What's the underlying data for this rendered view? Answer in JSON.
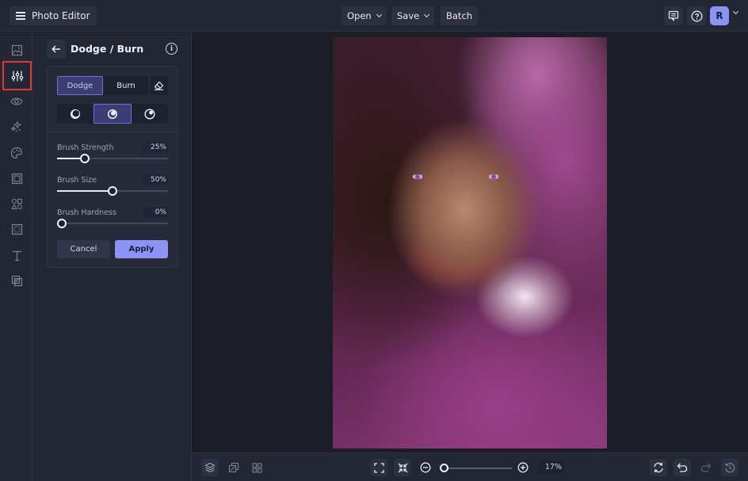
{
  "app": {
    "title": "Photo Editor"
  },
  "topbar": {
    "menu": [
      {
        "label": "Open",
        "has_dropdown": true
      },
      {
        "label": "Save",
        "has_dropdown": true
      },
      {
        "label": "Batch",
        "has_dropdown": false
      }
    ],
    "right_icons": [
      "feedback-icon",
      "help-icon"
    ],
    "avatar_initial": "R"
  },
  "rail": {
    "items": [
      {
        "name": "image",
        "icon": "image-icon",
        "active": false
      },
      {
        "name": "adjustments",
        "icon": "sliders-icon",
        "active": true
      },
      {
        "name": "effects",
        "icon": "eye-icon",
        "active": false
      },
      {
        "name": "touch-up",
        "icon": "sparkles-icon",
        "active": false
      },
      {
        "name": "artsy",
        "icon": "palette-icon",
        "active": false
      },
      {
        "name": "frames",
        "icon": "frame-icon",
        "active": false
      },
      {
        "name": "graphics",
        "icon": "shapes-icon",
        "active": false
      },
      {
        "name": "textures",
        "icon": "texture-icon",
        "active": false
      },
      {
        "name": "text",
        "icon": "text-icon",
        "active": false
      },
      {
        "name": "overlays",
        "icon": "overlay-icon",
        "active": false
      }
    ]
  },
  "panel": {
    "title": "Dodge / Burn",
    "mode_tabs": [
      {
        "label": "Dodge",
        "active": true
      },
      {
        "label": "Burn",
        "active": false
      }
    ],
    "eraser_icon": "eraser-icon",
    "tone_ranges": [
      {
        "name": "shadows",
        "active": false
      },
      {
        "name": "midtones",
        "active": true
      },
      {
        "name": "highlights",
        "active": false
      }
    ],
    "sliders": [
      {
        "label": "Brush Strength",
        "value": 25,
        "display": "25%"
      },
      {
        "label": "Brush Size",
        "value": 50,
        "display": "50%"
      },
      {
        "label": "Brush Hardness",
        "value": 0,
        "display": "0%"
      }
    ],
    "cancel_label": "Cancel",
    "apply_label": "Apply"
  },
  "colors": {
    "accent": "#8b93f5",
    "active_highlight": "#e0392b",
    "background": "#1d1f28",
    "panel": "#232633"
  },
  "bottombar": {
    "left_icons": [
      "layers-icon",
      "replace-image-icon",
      "grid-icon"
    ],
    "fit_icons": [
      "fit-screen-icon",
      "actual-size-icon"
    ],
    "zoom": {
      "value": 17,
      "display": "17%"
    },
    "right_icons": [
      "rotate-refresh-icon",
      "undo-icon",
      "redo-icon",
      "history-icon"
    ]
  }
}
